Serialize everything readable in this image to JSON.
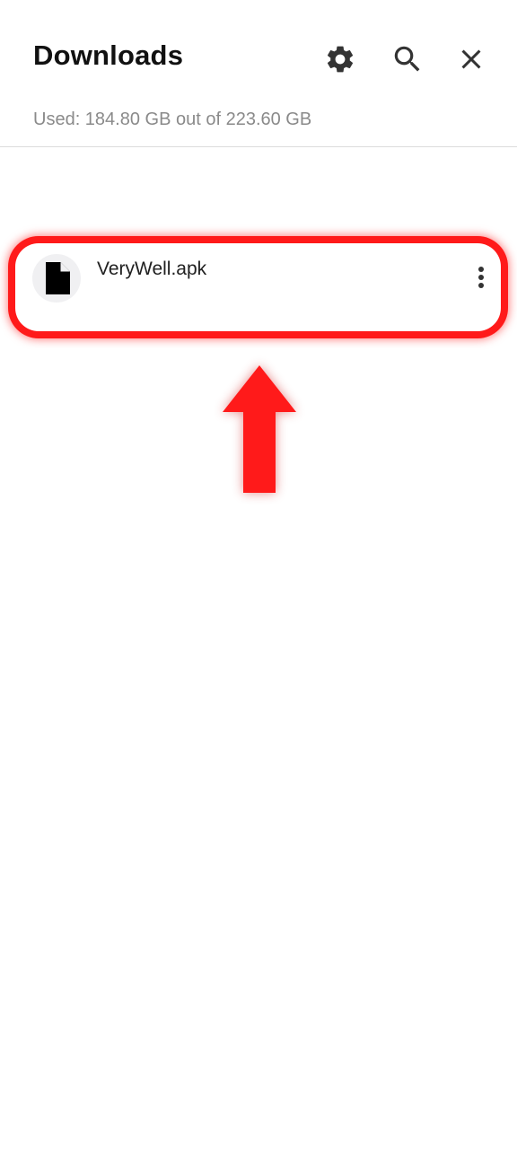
{
  "header": {
    "title": "Downloads",
    "settings_icon": "gear-icon",
    "search_icon": "search-icon",
    "close_icon": "close-icon"
  },
  "storage": {
    "text": "Used: 184.80 GB out of 223.60 GB"
  },
  "list": {
    "date_header": "",
    "items": [
      {
        "name": "VeryWell.apk",
        "meta": "",
        "icon": "file-icon",
        "menu_icon": "more-vert-icon"
      }
    ]
  },
  "annotation": {
    "highlight_color": "#ff1a1a",
    "arrow_icon": "arrow-up-icon"
  }
}
